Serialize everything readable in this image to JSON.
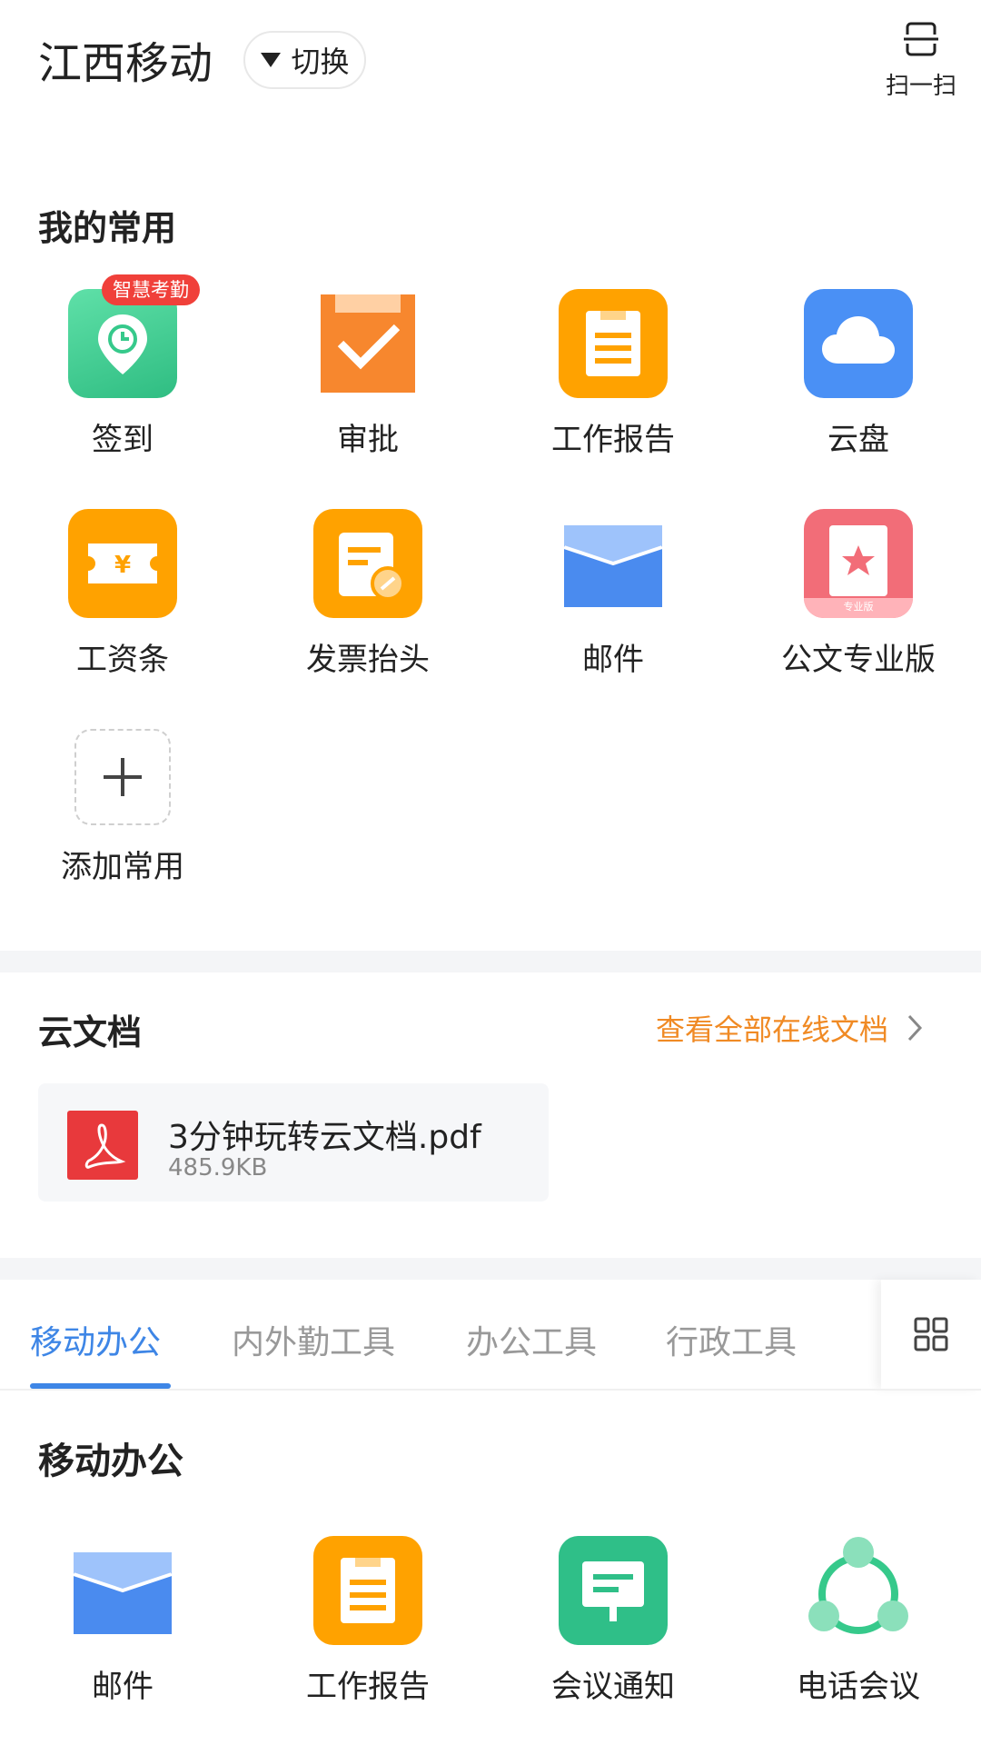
{
  "header": {
    "org_name": "江西移动",
    "switch_label": "切换",
    "scan_label": "扫一扫"
  },
  "favorites": {
    "title": "我的常用",
    "badge": "智慧考勤",
    "items": [
      {
        "label": "签到",
        "icon": "location-clock-icon",
        "color": "#36c98b"
      },
      {
        "label": "审批",
        "icon": "checkmark-clipboard-icon",
        "color": "#f7872e"
      },
      {
        "label": "工作报告",
        "icon": "report-icon",
        "color": "#ffa200"
      },
      {
        "label": "云盘",
        "icon": "cloud-icon",
        "color": "#4a90f5"
      },
      {
        "label": "工资条",
        "icon": "salary-ticket-icon",
        "color": "#ffa200"
      },
      {
        "label": "发票抬头",
        "icon": "invoice-icon",
        "color": "#ffa200"
      },
      {
        "label": "邮件",
        "icon": "mail-envelope-icon",
        "color": "#4a8bef"
      },
      {
        "label": "公文专业版",
        "icon": "document-star-icon",
        "color": "#f26d78"
      },
      {
        "label": "添加常用",
        "icon": "plus-icon",
        "color": "#ffffff"
      }
    ],
    "pro_tag": "专业版"
  },
  "cloud_docs": {
    "title": "云文档",
    "view_all": "查看全部在线文档",
    "file_name": "3分钟玩转云文档.pdf",
    "file_size": "485.9KB",
    "accent": "#f08a24"
  },
  "tabs": {
    "items": [
      "移动办公",
      "内外勤工具",
      "办公工具",
      "行政工具"
    ],
    "active_index": 0,
    "accent": "#3e86e6"
  },
  "mobile_office": {
    "title": "移动办公",
    "items": [
      {
        "label": "邮件",
        "icon": "mail-envelope-icon"
      },
      {
        "label": "工作报告",
        "icon": "report-icon"
      },
      {
        "label": "会议通知",
        "icon": "meeting-notice-icon"
      },
      {
        "label": "电话会议",
        "icon": "conference-call-icon"
      }
    ]
  }
}
